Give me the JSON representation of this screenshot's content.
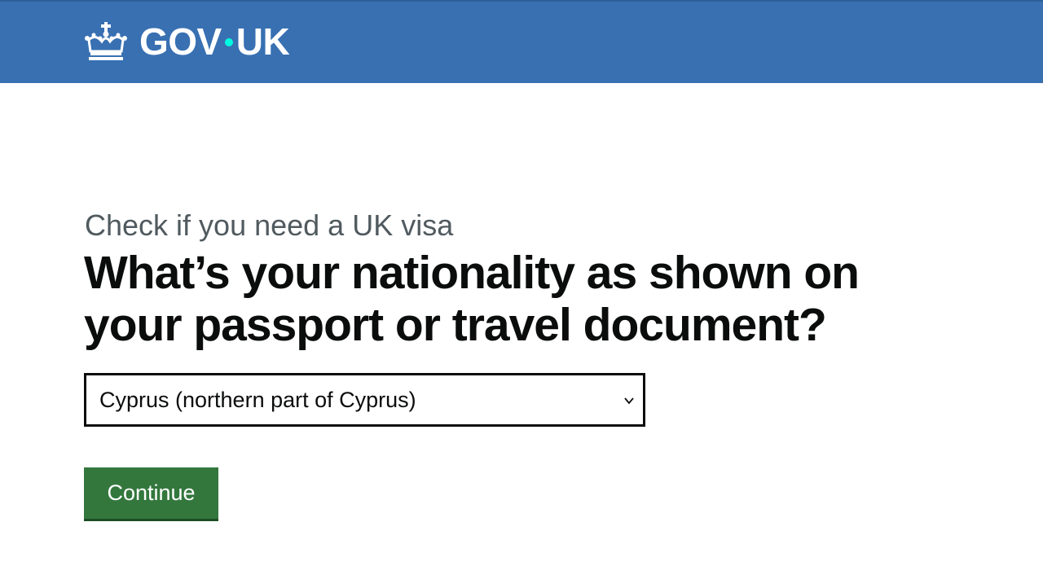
{
  "header": {
    "logo_text_left": "GOV",
    "logo_text_right": "UK",
    "logo_icon": "crown-icon",
    "background_color": "#3870b2",
    "dot_color": "#00ffe0"
  },
  "main": {
    "caption": "Check if you need a UK visa",
    "question": "What’s your nationality as shown on your passport or travel document?",
    "nationality_select": {
      "selected_value": "Cyprus (northern part of Cyprus)",
      "icon": "chevron-down-icon"
    },
    "continue_label": "Continue",
    "button_color": "#33773d"
  }
}
